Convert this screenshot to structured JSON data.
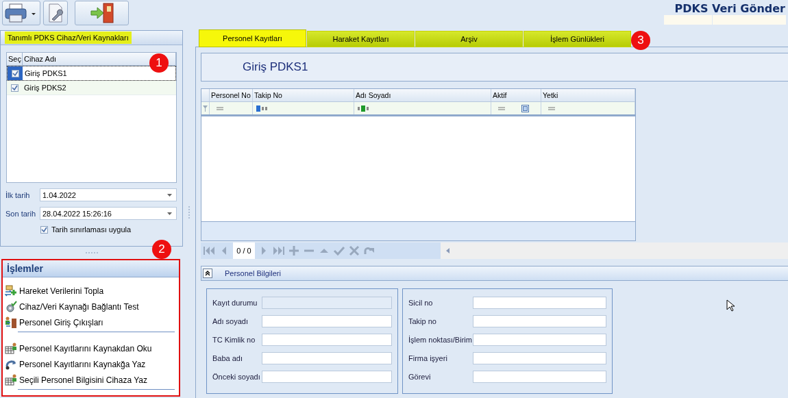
{
  "app_title": "PDKS Veri Gönder",
  "sources_panel": {
    "title": "Tanımlı PDKS Cihaz/Veri Kaynakları",
    "badge": "1",
    "columns": [
      "Seç",
      "Cihaz Adı"
    ],
    "rows": [
      {
        "name": "Giriş PDKS1",
        "checked": true,
        "selected": true
      },
      {
        "name": "Giriş PDKS2",
        "checked": true,
        "selected": false
      }
    ],
    "first_date": {
      "label": "İlk tarih",
      "value": "1.04.2022"
    },
    "last_date": {
      "label": "Son tarih",
      "value": "28.04.2022 15:26:16"
    },
    "date_limit": {
      "label": "Tarih sınırlaması uygula",
      "checked": true
    }
  },
  "actions_panel": {
    "title": "İşlemler",
    "badge": "2",
    "groups": [
      [
        {
          "label": "Hareket Verilerini Topla",
          "kind": "collect"
        },
        {
          "label": "Cihaz/Veri Kaynağı Bağlantı Test",
          "kind": "test"
        },
        {
          "label": "Personel Giriş Çıkışları",
          "kind": "door"
        }
      ],
      [
        {
          "label": "Personel Kayıtlarını Kaynakdan Oku",
          "kind": "table"
        },
        {
          "label": "Personel Kayıtlarını Kaynakğa Yaz",
          "kind": "write"
        },
        {
          "label": "Seçili Personel Bilgisini Cihaza Yaz",
          "kind": "table"
        }
      ]
    ]
  },
  "tabs": [
    {
      "label": "Personel Kayıtları",
      "selected": true
    },
    {
      "label": "Haraket Kayıtları",
      "selected": false
    },
    {
      "label": "Arşiv",
      "selected": false
    },
    {
      "label": "İşlem Günlükleri",
      "selected": false
    }
  ],
  "tabs_badge": "3",
  "device_title": "Giriş PDKS1",
  "grid": {
    "columns": [
      {
        "label": "Personel No",
        "kind": "equals"
      },
      {
        "label": "Takip No",
        "kind": "text"
      },
      {
        "label": "Adı Soyadı",
        "kind": "text-green"
      },
      {
        "label": "Aktif",
        "kind": "check"
      },
      {
        "label": "Yetki",
        "kind": "equals"
      }
    ]
  },
  "navigator": {
    "position": "0 / 0"
  },
  "details": {
    "title": "Personel Bilgileri",
    "left_fields": [
      {
        "label": "Kayıt durumu",
        "disabled": true
      },
      {
        "label": "Adı soyadı",
        "disabled": false
      },
      {
        "label": "TC Kimlik no",
        "disabled": false
      },
      {
        "label": "Baba adı",
        "disabled": false
      },
      {
        "label": "Önceki soyadı",
        "disabled": false
      }
    ],
    "right_fields": [
      {
        "label": "Sicil no",
        "disabled": false
      },
      {
        "label": "Takip no",
        "disabled": false
      },
      {
        "label": "İşlem noktası/Birim",
        "disabled": false
      },
      {
        "label": "Firma işyeri",
        "disabled": false
      },
      {
        "label": "Görevi",
        "disabled": false
      }
    ]
  }
}
